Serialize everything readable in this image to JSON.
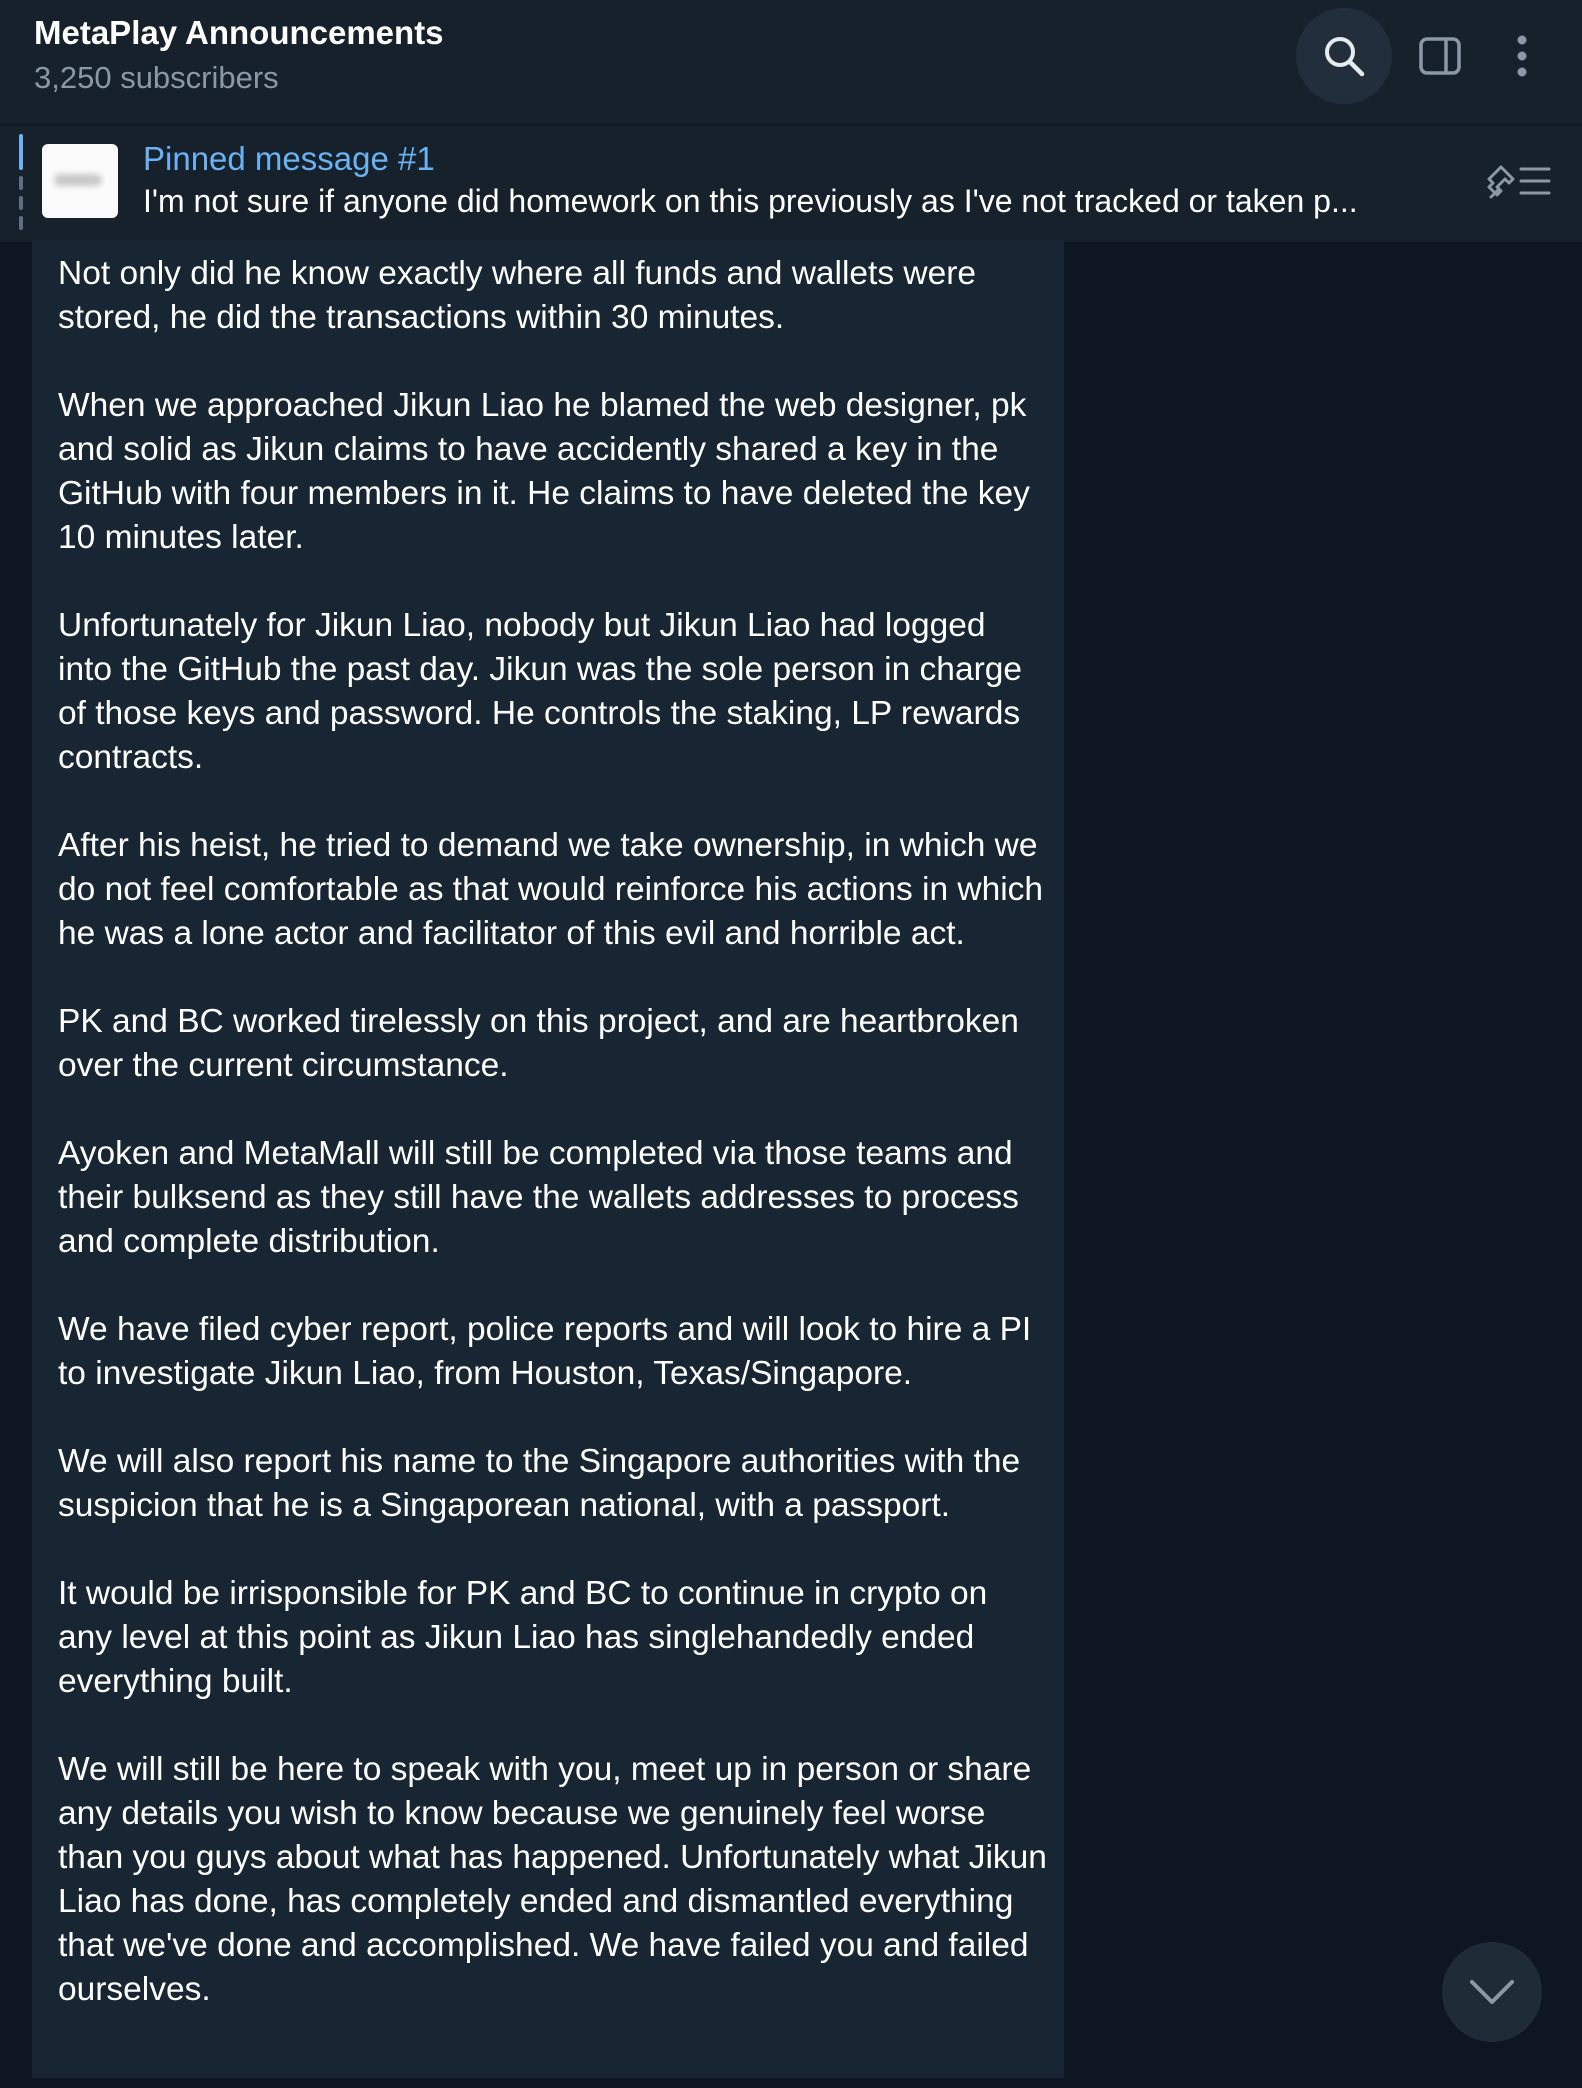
{
  "header": {
    "title": "MetaPlay Announcements",
    "subscribers": "3,250 subscribers",
    "icons": [
      "search-icon",
      "sidebar-toggle-icon",
      "more-vertical-icon"
    ]
  },
  "pinned": {
    "title": "Pinned message #1",
    "preview": "I'm not sure if anyone did homework on this previously as I've not tracked or taken p..."
  },
  "message": {
    "paragraphs": [
      "Not only did he know exactly where all funds and wallets were stored, he did the transactions within 30 minutes.",
      "When we approached Jikun Liao he blamed the web designer, pk and solid as Jikun claims to have accidently shared a key in the GitHub with four members in it. He claims to have deleted the key 10 minutes later.",
      "Unfortunately for Jikun Liao, nobody but Jikun Liao had logged into the GitHub the past day. Jikun was the sole person in charge of those keys and password. He controls the staking, LP rewards contracts.",
      "After his heist, he tried to demand we take ownership, in which we do not feel comfortable as that would reinforce his actions in which he was a lone actor and facilitator of this evil and horrible act.",
      "PK and BC worked tirelessly on this project, and are heartbroken over the current circumstance.",
      "Ayoken and MetaMall will still be completed via those teams and their bulksend as they still have the wallets addresses to process and complete distribution.",
      "We have filed cyber report, police reports and will look to hire a PI to investigate Jikun Liao, from Houston, Texas/Singapore.",
      "We will also report his name to the Singapore authorities with the suspicion that he is a Singaporean national, with a passport.",
      "It would be irrisponsible for PK and BC to continue in crypto on any level at this point as Jikun Liao has singlehandedly ended everything built.",
      "We will still be here to speak with you, meet up in person or share any details you wish to know because we genuinely feel worse than you guys about what has happened. Unfortunately what Jikun Liao has done, has completely ended and dismantled everything that we've done and accomplished. We have failed you and failed ourselves."
    ]
  },
  "colors": {
    "background": "#0e1621",
    "header": "#17212b",
    "bubble": "#182533",
    "accent": "#6ab2f2",
    "muted": "#8b98a6"
  }
}
